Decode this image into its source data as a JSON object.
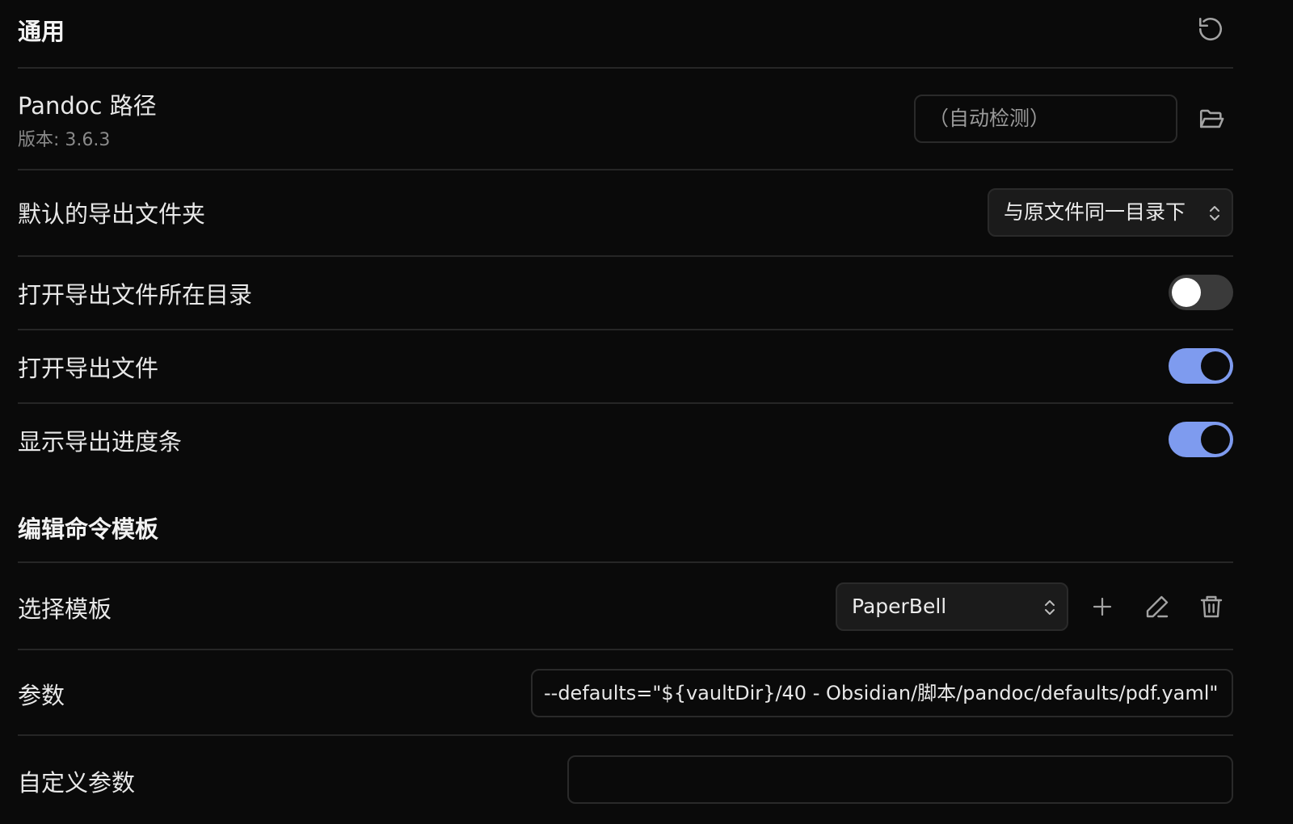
{
  "general": {
    "title": "通用",
    "reset_icon": "reset-icon"
  },
  "pandoc": {
    "label": "Pandoc 路径",
    "version": "版本: 3.6.3",
    "path_placeholder": "（自动检测）",
    "folder_icon": "folder-open-icon"
  },
  "export_folder": {
    "label": "默认的导出文件夹",
    "selected": "与原文件同一目录下"
  },
  "open_folder": {
    "label": "打开导出文件所在目录",
    "enabled": false
  },
  "open_file": {
    "label": "打开导出文件",
    "enabled": true
  },
  "show_progress": {
    "label": "显示导出进度条",
    "enabled": true
  },
  "templates": {
    "title": "编辑命令模板",
    "select_label": "选择模板",
    "selected": "PaperBell",
    "icons": [
      "plus-icon",
      "pencil-icon",
      "trash-icon"
    ]
  },
  "params": {
    "label": "参数",
    "value": "--defaults=\"${vaultDir}/40 - Obsidian/脚本/pandoc/defaults/pdf.yaml\""
  },
  "custom_params": {
    "label": "自定义参数",
    "value": ""
  },
  "colors": {
    "background": "#0a0a0a",
    "accent": "#7e9bef",
    "divider": "#262626",
    "muted_text": "#8a8a8a"
  }
}
